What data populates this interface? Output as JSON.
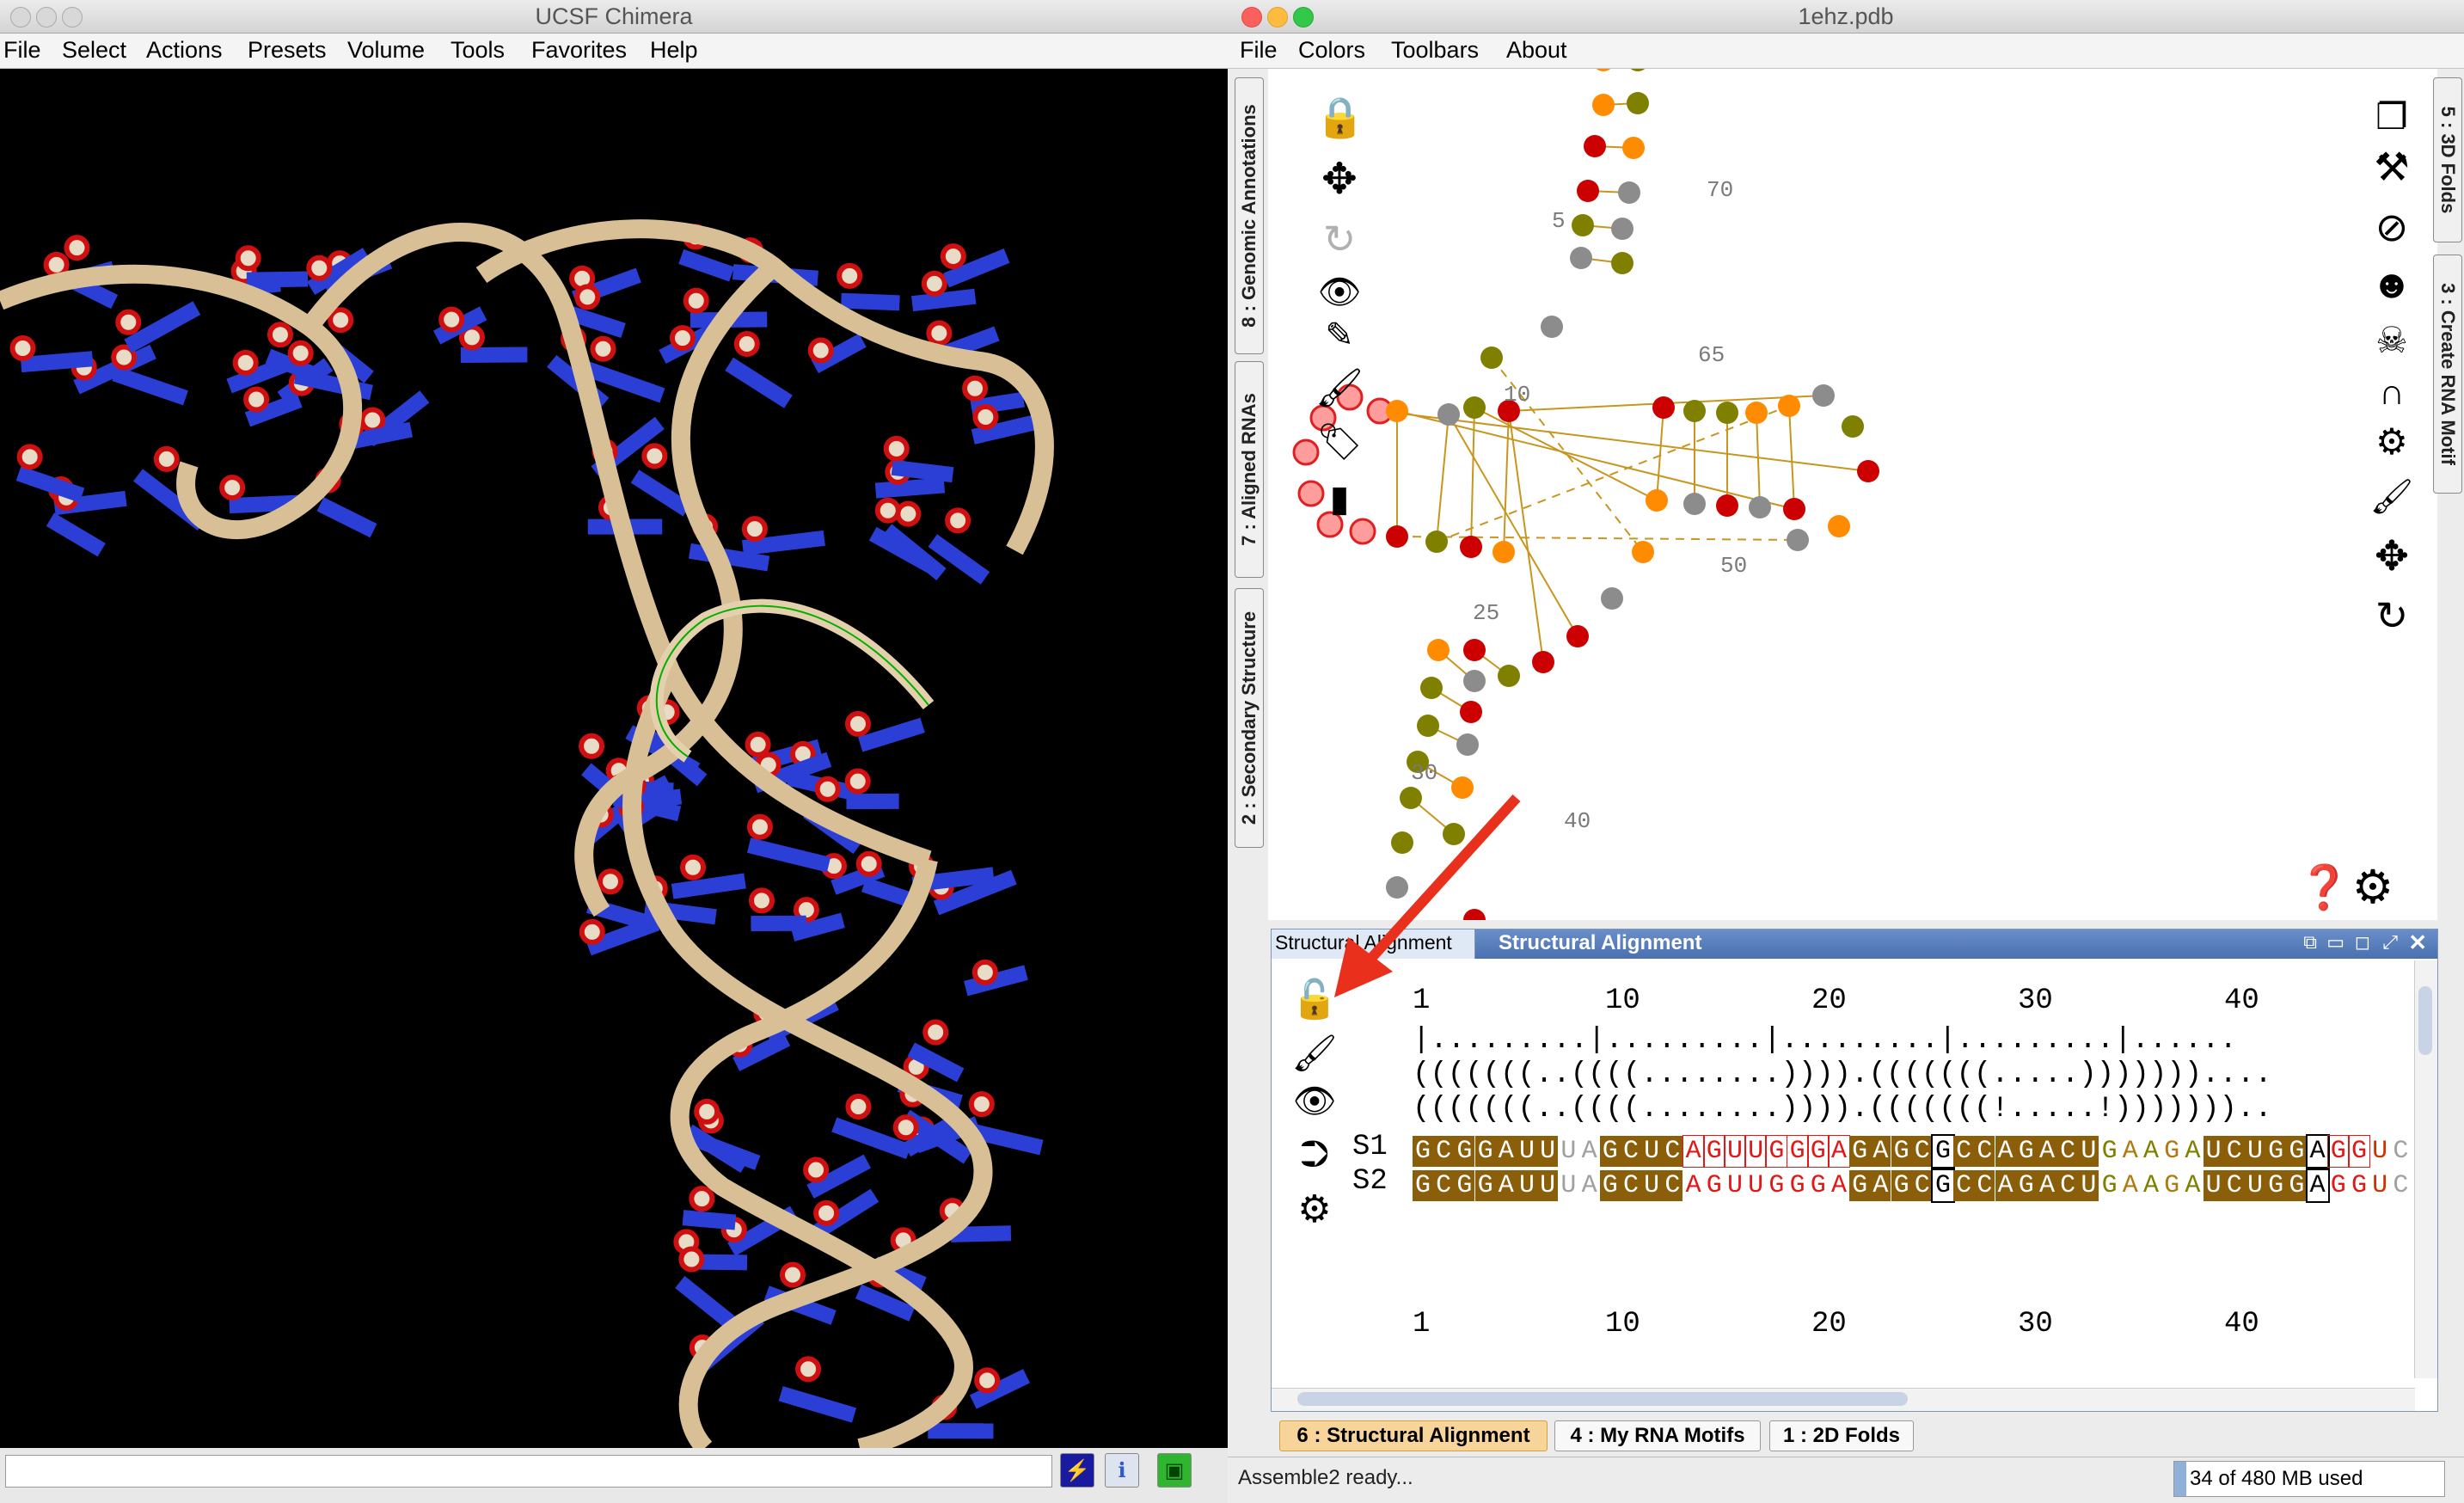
{
  "chimera": {
    "title": "UCSF Chimera",
    "menu": [
      "File",
      "Select",
      "Actions",
      "Presets",
      "Volume",
      "Tools",
      "Favorites",
      "Help"
    ],
    "icons": [
      "lightning-icon",
      "info-icon",
      "image-icon"
    ]
  },
  "assemble": {
    "title": "1ehz.pdb",
    "menu": [
      "File",
      "Colors",
      "Toolbars",
      "About"
    ],
    "left_tabs": [
      "8 : Genomic Annotations",
      "7 : Aligned RNAs",
      "2 : Secondary Structure"
    ],
    "right_tabs": [
      "5 : 3D Folds",
      "3 : Create RNA Motif"
    ],
    "drawing_labels": [
      "70",
      "5",
      "65",
      "10",
      "50",
      "25",
      "30",
      "40"
    ],
    "alignment": {
      "tab_label": "Structural Alignment",
      "header_title": "Structural Alignment",
      "ruler": [
        "1",
        "10",
        "20",
        "30",
        "40"
      ],
      "ruler_ticks": "|.........|.........|.........|.........|......",
      "structure_1": "(((((((..((((........)))).(((((((.....)))))))....",
      "structure_2": "(((((((..((((........)))).(((((((!.....!)))))))..",
      "seq_names": [
        "S1",
        "S2"
      ],
      "sequences": [
        "GCGGAUUUAGCUCAGUUGGGAGAGCGCCAGACUGAAGAUCUGGAGGUC",
        "GCGGAUUUAGCUCAGUUGGGAGAGCGCCAGACUGAAGAUCUGGAGGUC"
      ]
    },
    "bottom_tabs": [
      "6 : Structural Alignment",
      "4 : My RNA Motifs",
      "1 : 2D Folds"
    ],
    "status": "Assemble2 ready...",
    "memory": "34 of 480 MB used"
  },
  "colors": {
    "olive": "#7f7f00",
    "orange": "#ff8c00",
    "red": "#cc0000",
    "gray": "#8c8c8c",
    "pink": "#ff9c9c",
    "helix_bg": "#8b5e0a",
    "accent": "#4a70b0",
    "tab_highlight": "#f6d49a"
  }
}
